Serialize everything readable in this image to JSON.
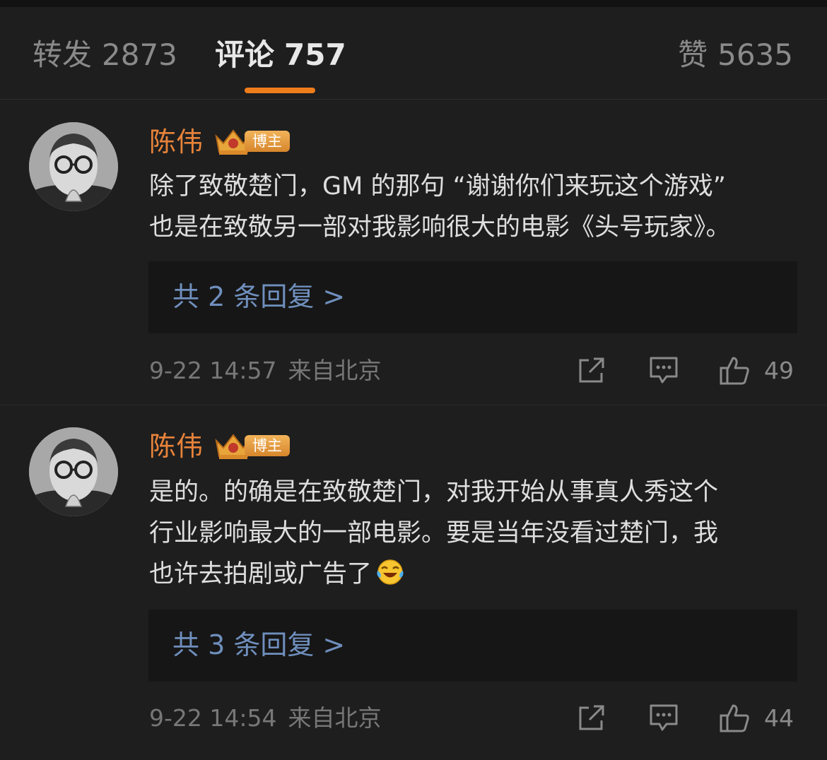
{
  "tabs": {
    "reposts": {
      "label": "转发",
      "count": "2873"
    },
    "comments": {
      "label": "评论",
      "count": "757"
    },
    "likes": {
      "label": "赞",
      "count": "5635"
    }
  },
  "comments": [
    {
      "username": "陈伟",
      "badge": "博主",
      "text": "除了致敬楚门，GM 的那句 “谢谢你们来玩这个游戏”\n也是在致敬另一部对我影响很大的电影《头号玩家》。",
      "replies_link": "共 2 条回复 >",
      "time": "9-22 14:57",
      "location": "来自北京",
      "likes": "49"
    },
    {
      "username": "陈伟",
      "badge": "博主",
      "text": "是的。的确是在致敬楚门，对我开始从事真人秀这个\n行业影响最大的一部电影。要是当年没看过楚门，我\n也许去拍剧或广告了",
      "emoji": "laughing-crying-emoji",
      "replies_link": "共 3 条回复 >",
      "time": "9-22 14:54",
      "location": "来自北京",
      "likes": "44"
    }
  ],
  "colors": {
    "background": "#1e1e1e",
    "username": "#e8833a",
    "tab_indicator": "#ee7d1c",
    "reply_link": "#6f8fbd"
  }
}
